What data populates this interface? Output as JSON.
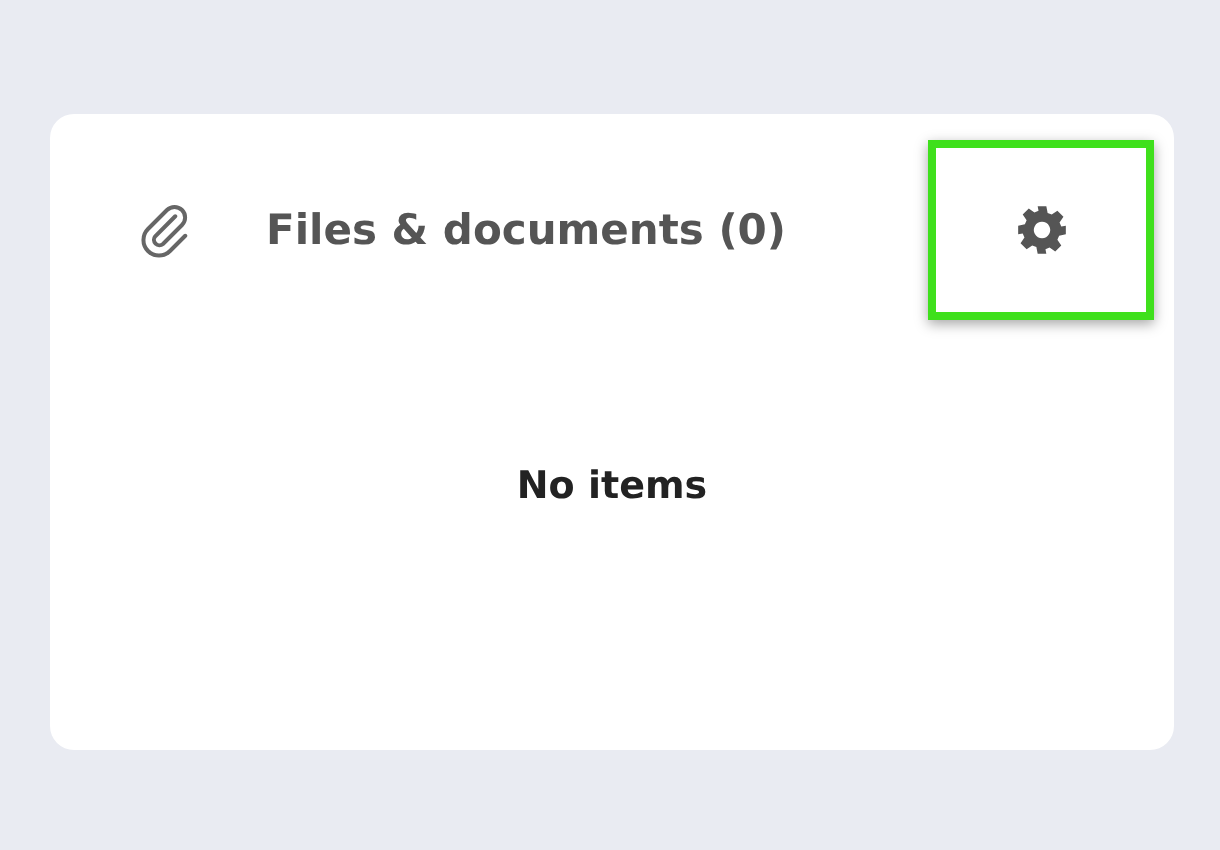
{
  "panel": {
    "title": "Files & documents (0)",
    "settings": {
      "highlighted": true
    },
    "empty_message": "No items"
  }
}
